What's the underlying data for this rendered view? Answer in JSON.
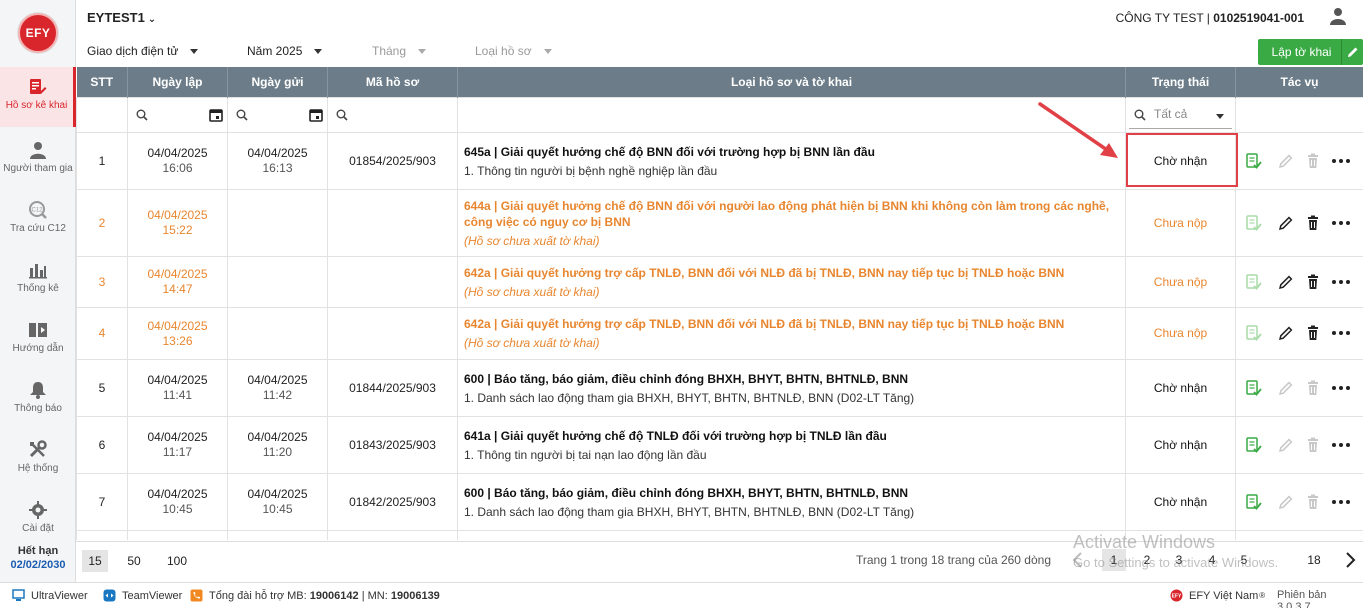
{
  "app": {
    "logo_text": "EFY",
    "org_name": "EYTEST1",
    "company_name": "CÔNG TY TEST | ",
    "company_tax": "0102519041-001"
  },
  "sidebar": {
    "items": [
      {
        "label": "Hồ sơ kê khai",
        "icon": "document-edit-icon",
        "active": true
      },
      {
        "label": "Người tham gia",
        "icon": "person-icon"
      },
      {
        "label": "Tra cứu C12",
        "icon": "search-circle-icon"
      },
      {
        "label": "Thống kê",
        "icon": "bar-chart-icon"
      },
      {
        "label": "Hướng dẫn",
        "icon": "video-guide-icon"
      },
      {
        "label": "Thông báo",
        "icon": "bell-icon"
      },
      {
        "label": "Hệ thống",
        "icon": "tools-icon"
      },
      {
        "label": "Cài đặt",
        "icon": "gear-icon"
      }
    ],
    "expire_label": "Hết hạn",
    "expire_date": "02/02/2030"
  },
  "filters": {
    "type": "Giao dịch điện tử",
    "year": "Năm 2025",
    "month": "Tháng",
    "record_type": "Loại hồ sơ",
    "create_button": "Lập tờ khai"
  },
  "table": {
    "headers": [
      "STT",
      "Ngày lập",
      "Ngày gửi",
      "Mã hồ sơ",
      "Loại hồ sơ và tờ khai",
      "Trạng thái",
      "Tác vụ"
    ],
    "status_filter_placeholder": "Tất cả",
    "rows": [
      {
        "stt": "1",
        "created_date": "04/04/2025",
        "created_time": "16:06",
        "sent_date": "04/04/2025",
        "sent_time": "16:13",
        "code": "01854/2025/903",
        "title": "645a | Giải quyết hưởng chế độ BNN đối với trường hợp bị BNN lần đầu",
        "sub": "1. Thông tin người bị bệnh nghề nghiệp lần đầu",
        "status": "Chờ nhận",
        "pending": false
      },
      {
        "stt": "2",
        "created_date": "04/04/2025",
        "created_time": "15:22",
        "sent_date": "",
        "sent_time": "",
        "code": "",
        "title": "644a | Giải quyết hưởng chế độ BNN đối với người lao động phát hiện bị BNN khi không còn làm trong các nghề, công việc có nguy cơ bị BNN",
        "sub": "(Hồ sơ chưa xuất tờ khai)",
        "status": "Chưa nộp",
        "pending": true
      },
      {
        "stt": "3",
        "created_date": "04/04/2025",
        "created_time": "14:47",
        "sent_date": "",
        "sent_time": "",
        "code": "",
        "title": "642a | Giải quyết hưởng trợ cấp TNLĐ, BNN đối với NLĐ đã bị TNLĐ, BNN nay tiếp tục bị TNLĐ hoặc BNN",
        "sub": "(Hồ sơ chưa xuất tờ khai)",
        "status": "Chưa nộp",
        "pending": true
      },
      {
        "stt": "4",
        "created_date": "04/04/2025",
        "created_time": "13:26",
        "sent_date": "",
        "sent_time": "",
        "code": "",
        "title": "642a | Giải quyết hưởng trợ cấp TNLĐ, BNN đối với NLĐ đã bị TNLĐ, BNN nay tiếp tục bị TNLĐ hoặc BNN",
        "sub": "(Hồ sơ chưa xuất tờ khai)",
        "status": "Chưa nộp",
        "pending": true
      },
      {
        "stt": "5",
        "created_date": "04/04/2025",
        "created_time": "11:41",
        "sent_date": "04/04/2025",
        "sent_time": "11:42",
        "code": "01844/2025/903",
        "title": "600 | Báo tăng, báo giảm, điều chỉnh đóng BHXH, BHYT, BHTN, BHTNLĐ, BNN",
        "sub": "1. Danh sách lao động tham gia BHXH, BHYT, BHTN, BHTNLĐ, BNN (D02-LT Tăng)",
        "status": "Chờ nhận",
        "pending": false
      },
      {
        "stt": "6",
        "created_date": "04/04/2025",
        "created_time": "11:17",
        "sent_date": "04/04/2025",
        "sent_time": "11:20",
        "code": "01843/2025/903",
        "title": "641a | Giải quyết hưởng chế độ TNLĐ đối với trường hợp bị TNLĐ lần đầu",
        "sub": "1. Thông tin người bị tai nạn lao động lần đầu",
        "status": "Chờ nhận",
        "pending": false
      },
      {
        "stt": "7",
        "created_date": "04/04/2025",
        "created_time": "10:45",
        "sent_date": "04/04/2025",
        "sent_time": "10:45",
        "code": "01842/2025/903",
        "title": "600 | Báo tăng, báo giảm, điều chỉnh đóng BHXH, BHYT, BHTN, BHTNLĐ, BNN",
        "sub": "1. Danh sách lao động tham gia BHXH, BHYT, BHTN, BHTNLĐ, BNN (D02-LT Tăng)",
        "status": "Chờ nhận",
        "pending": false
      }
    ]
  },
  "pager": {
    "sizes": [
      "15",
      "50",
      "100"
    ],
    "selected_size": "15",
    "info": "Trang 1 trong 18 trang của 260 dòng",
    "pages": [
      "1",
      "2",
      "3",
      "4",
      "5",
      "18"
    ],
    "current_page": "1"
  },
  "watermark": {
    "line1": "Activate Windows",
    "line2": "Go to Settings to activate Windows."
  },
  "footer": {
    "ultraviewer": "UltraViewer",
    "teamviewer": "TeamViewer",
    "hotline_prefix": "Tổng đài hỗ trợ MB: ",
    "hotline_mb": "19006142",
    "hotline_sep": " | MN: ",
    "hotline_mn": "19006139",
    "brand": "EFY Việt Nam",
    "version": "Phiên bản 3.0.3.7"
  },
  "colors": {
    "brand_red": "#d8262c",
    "header_gray": "#6c7d89",
    "pending_orange": "#e8862f",
    "create_green": "#3aaa45",
    "highlight_red": "#e04046"
  }
}
